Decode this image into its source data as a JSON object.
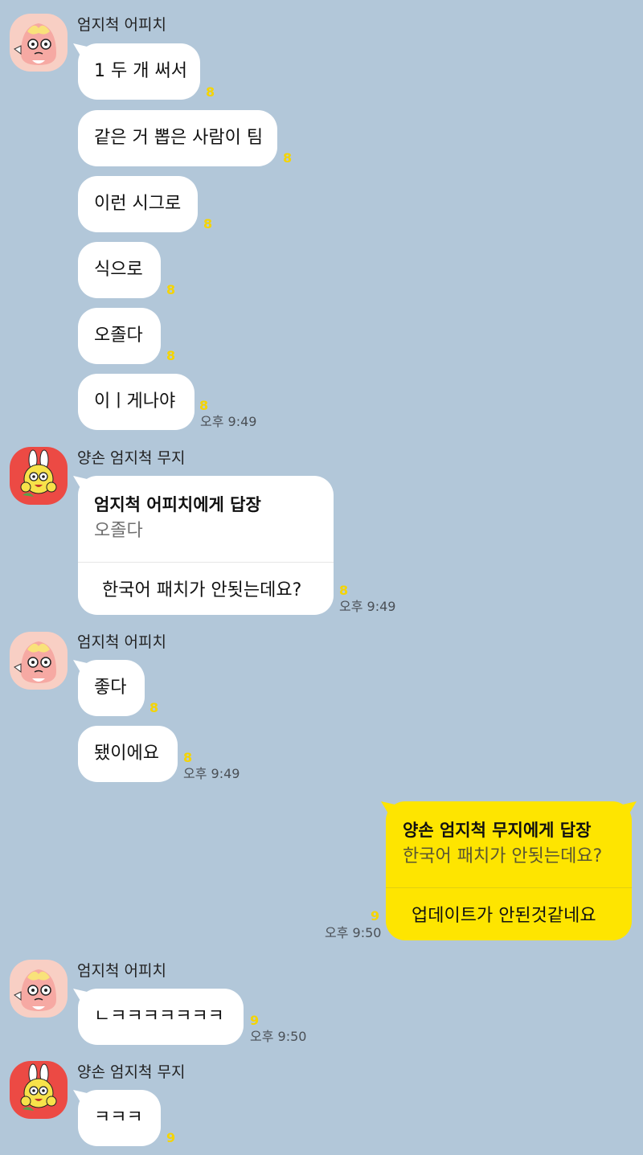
{
  "participants": {
    "apeach": {
      "name": "엄지척 어피치",
      "avatar_icon": "apeach-character-icon",
      "avatar_bg": "#f8cfc4"
    },
    "muzi": {
      "name": "양손 엄지척 무지",
      "avatar_icon": "muzi-character-icon",
      "avatar_bg": "#ec4a44"
    }
  },
  "colors": {
    "background": "#b2c7d9",
    "bubble_other": "#ffffff",
    "bubble_mine": "#fee500",
    "unread_count": "#f5d400"
  },
  "group1": {
    "sender": "엄지척 어피치",
    "messages": [
      {
        "text": "1 두 개 써서",
        "unread": "8"
      },
      {
        "text": "같은 거 뽑은 사람이 팀",
        "unread": "8"
      },
      {
        "text": "이런 시그로",
        "unread": "8"
      },
      {
        "text": "식으로",
        "unread": "8"
      },
      {
        "text": "오졸다",
        "unread": "8"
      },
      {
        "text": "이ㅣ게나야",
        "unread": "8"
      }
    ],
    "time": "오후 9:49"
  },
  "group2": {
    "sender": "양손 엄지척 무지",
    "reply": {
      "title": "엄지척 어피치에게 답장",
      "quote": "오졸다",
      "text": "한국어 패치가 안됫는데요?"
    },
    "unread": "8",
    "time": "오후 9:49"
  },
  "group3": {
    "sender": "엄지척 어피치",
    "messages": [
      {
        "text": "좋다",
        "unread": "8"
      },
      {
        "text": "됐이에요",
        "unread": "8"
      }
    ],
    "time": "오후 9:49"
  },
  "group4": {
    "reply": {
      "title": "양손 엄지척 무지에게 답장",
      "quote": "한국어 패치가 안됫는데요?",
      "text": "업데이트가 안된것같네요"
    },
    "unread": "9",
    "time": "오후 9:50"
  },
  "group5": {
    "sender": "엄지척 어피치",
    "messages": [
      {
        "text": "ㄴㅋㅋㅋㅋㅋㅋㅋ",
        "unread": "9"
      }
    ],
    "time": "오후 9:50"
  },
  "group6": {
    "sender": "양손 엄지척 무지",
    "messages": [
      {
        "text": "ㅋㅋㅋ",
        "unread": "9"
      }
    ]
  }
}
